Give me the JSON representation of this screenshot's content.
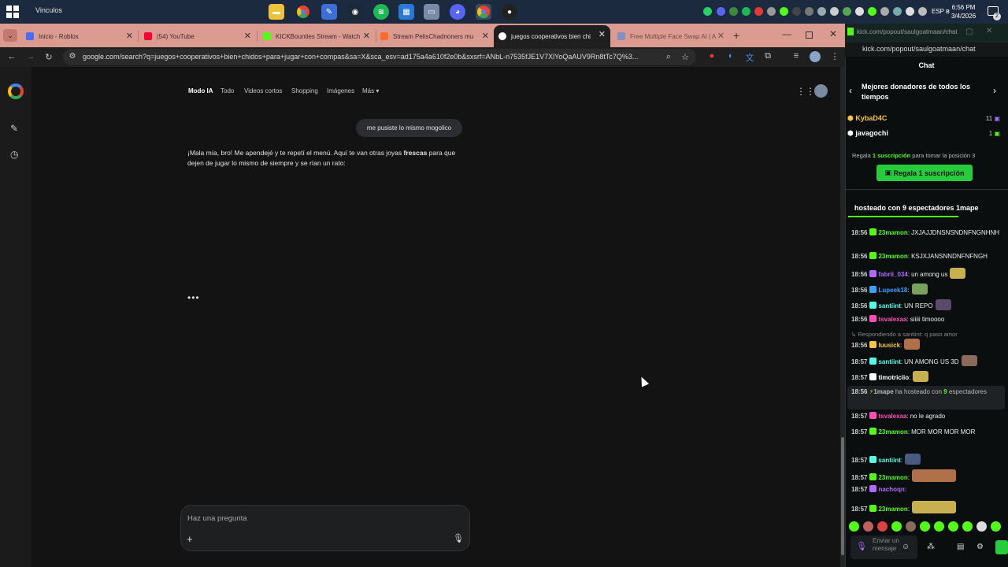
{
  "taskbar": {
    "label": "Vinculos",
    "clock_time": "6:56 PM",
    "clock_date": "3/4/2026",
    "lang": "ESP",
    "notif_count": "2"
  },
  "tabs": [
    {
      "title": "Inicio - Roblox",
      "color": "#4a6cf7"
    },
    {
      "title": "(54) YouTube",
      "color": "#ff0033"
    },
    {
      "title": "KICKBounties Stream - Watch",
      "color": "#53fc18"
    },
    {
      "title": "Stream PelisChadnoners mu",
      "color": "#ff6b2d"
    },
    {
      "title": "juegos cooperativos bien chi",
      "color": "#4285f4"
    },
    {
      "title": "Free Multiple Face Swap AI | A",
      "color": "#5f8bd8"
    }
  ],
  "toolbar": {
    "url": "google.com/search?q=juegos+cooperativos+bien+chidos+para+jugar+con+compas&sa=X&sca_esv=ad175a4a610f2e0b&sxsrf=ANbL-n7535fJE1V7XlYoQaAUV9Rn8tTc7Q%3..."
  },
  "google": {
    "nav": [
      "Modo IA",
      "Todo",
      "Videos cortos",
      "Shopping",
      "Imágenes",
      "Más"
    ],
    "user_msg": "me pusiste lo mismo mogolico",
    "answer_part1": "¡Mala mía, bro! Me apendejé y te repetí el menú. Aquí te van otras joyas ",
    "answer_bold": "frescas",
    "answer_part2": " para que dejen de jugar lo mismo de siempre y se rían un rato:",
    "loading": "•••",
    "ask_placeholder": "Haz una pregunta",
    "plus": "+"
  },
  "chat": {
    "url": "kick.com/popout/saulgoatmaan/chat",
    "title": "Chat",
    "donors_title": "Mejores donadores de todos los tiempos",
    "donors": [
      {
        "name": "KybaD4C",
        "count": "11",
        "color": "#f5c542"
      },
      {
        "name": "javagochi",
        "count": "1",
        "color": "#ffffff"
      }
    ],
    "gift_text_a": "Regala ",
    "gift_text_b": "1 suscripción",
    "gift_text_c": " para tomar la posición 3",
    "gift_button": "Regala 1 suscripción",
    "host_banner": "hosteado con 9 espectadores   1mape",
    "reply_text": "↳ Respondiendo a santiint: q paso amor",
    "host_msg_a": "1mape",
    "host_msg_b": " ha hosteado con ",
    "host_msg_c": "9",
    "host_msg_d": " espectadores",
    "input_placeholder": "Enviar un mensaje",
    "messages": [
      {
        "time": "18:56",
        "user": "23mamon",
        "color": "#53fc18",
        "text": "JXJAJJDNSNSNDNFNGNHNH"
      },
      {
        "time": "18:56",
        "user": "23mamon",
        "color": "#53fc18",
        "text": "KSJXJANSNNDNFNFNGH"
      },
      {
        "time": "18:56",
        "user": "fabrii_034",
        "color": "#b069ff",
        "text": "un among us"
      },
      {
        "time": "18:56",
        "user": "Lupeek18",
        "color": "#3aa0ff",
        "text": ""
      },
      {
        "time": "18:56",
        "user": "santiint",
        "color": "#53fce6",
        "text": "UN REPO"
      },
      {
        "time": "18:56",
        "user": "tsvalexaa",
        "color": "#ff4db8",
        "text": "siiiii timoooo"
      },
      {
        "time": "18:56",
        "user": "luusick",
        "color": "#f5c542",
        "text": ""
      },
      {
        "time": "18:57",
        "user": "santiint",
        "color": "#53fce6",
        "text": "UN AMONG US 3D"
      },
      {
        "time": "18:57",
        "user": "timotriciio",
        "color": "#ffffff",
        "text": ""
      },
      {
        "time": "18:57",
        "user": "tsvalexaa",
        "color": "#ff4db8",
        "text": "no le agrado"
      },
      {
        "time": "18:57",
        "user": "23mamon",
        "color": "#53fc18",
        "text": "MOR MOR MOR MOR"
      },
      {
        "time": "18:57",
        "user": "santiint",
        "color": "#53fce6",
        "text": ""
      },
      {
        "time": "18:57",
        "user": "23mamon",
        "color": "#53fc18",
        "text": ""
      },
      {
        "time": "18:57",
        "user": "nachoqn",
        "color": "#b069ff",
        "text": ""
      },
      {
        "time": "18:57",
        "user": "23mamon",
        "color": "#53fc18",
        "text": ""
      }
    ]
  }
}
